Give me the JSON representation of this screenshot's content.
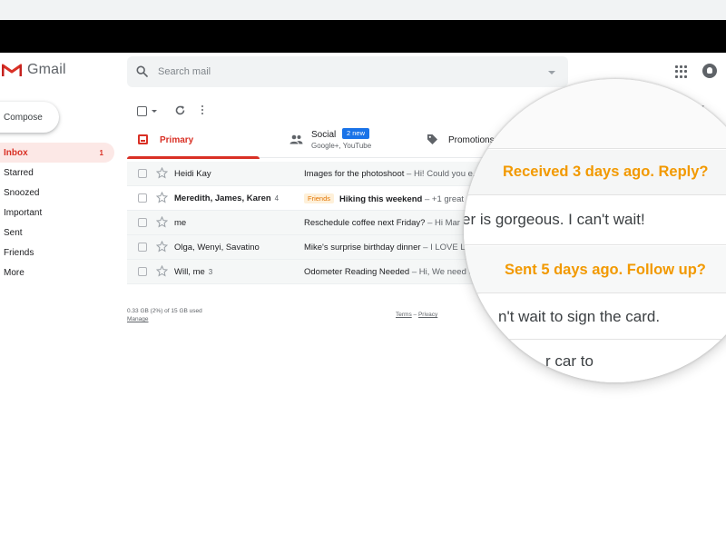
{
  "app": {
    "name": "Gmail"
  },
  "colors": {
    "accent": "#d93025",
    "nudge": "#f29900",
    "badge": "#1a73e8"
  },
  "search": {
    "placeholder": "Search mail"
  },
  "sidebar": {
    "compose_label": "Compose",
    "items": [
      {
        "label": "Inbox",
        "count": "1",
        "active": true
      },
      {
        "label": "Starred",
        "count": ""
      },
      {
        "label": "Snoozed",
        "count": ""
      },
      {
        "label": "Important",
        "count": ""
      },
      {
        "label": "Sent",
        "count": ""
      },
      {
        "label": "Friends",
        "count": ""
      },
      {
        "label": "More",
        "count": ""
      }
    ]
  },
  "tabs": {
    "primary": {
      "label": "Primary"
    },
    "social": {
      "label": "Social",
      "badge": "2 new",
      "sub": "Google+, YouTube"
    },
    "promotions": {
      "label": "Promotions"
    }
  },
  "emails": [
    {
      "sender": "Heidi Kay",
      "count": "",
      "label": "",
      "subject": "Images for the photoshoot",
      "snippet": " – Hi! Could you e...",
      "unread": false
    },
    {
      "sender": "Meredith, James, Karen",
      "count": "4",
      "label": "Friends",
      "subject": "Hiking this weekend",
      "snippet": " – +1 great",
      "unread": true
    },
    {
      "sender": "me",
      "count": "",
      "label": "",
      "subject": "Reschedule coffee next Friday?",
      "snippet": " – Hi Mar",
      "unread": false
    },
    {
      "sender": "Olga, Wenyi, Savatino",
      "count": "",
      "label": "",
      "subject": "Mike's surprise birthday dinner",
      "snippet": " – I LOVE L",
      "unread": false
    },
    {
      "sender": "Will, me",
      "count": "3",
      "label": "",
      "subject": "Odometer Reading Needed",
      "snippet": " – Hi, We need th",
      "unread": false
    }
  ],
  "footer": {
    "storage": "0.33 GB (2%) of 15 GB used",
    "manage": "Manage",
    "terms": "Terms",
    "separator": " – ",
    "privacy": "Privacy"
  },
  "magnifier": {
    "nudge_reply": "Received 3 days ago. Reply?",
    "line_gorgeous": "er is gorgeous.  I can't wait!",
    "nudge_follow": "Sent 5 days ago. Follow up?",
    "line_card": "n't wait to sign the card.",
    "line_partial": "r car to"
  }
}
